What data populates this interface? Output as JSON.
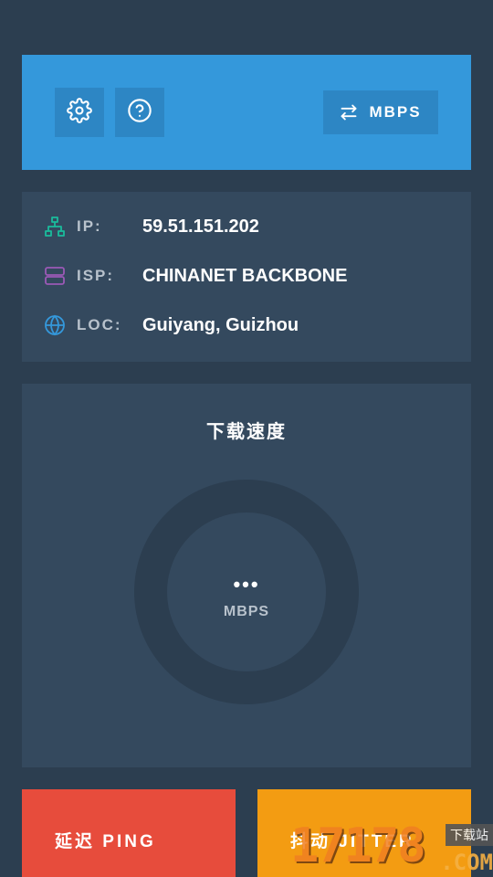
{
  "toolbar": {
    "settings_icon": "gear-icon",
    "help_icon": "question-circle-icon",
    "unit_toggle_icon": "swap-arrows-icon",
    "unit_label": "MBPS"
  },
  "info": {
    "ip": {
      "label": "IP:",
      "value": "59.51.151.202",
      "icon": "network-icon"
    },
    "isp": {
      "label": "ISP:",
      "value": "CHINANET BACKBONE",
      "icon": "server-icon"
    },
    "loc": {
      "label": "LOC:",
      "value": "Guiyang, Guizhou",
      "icon": "globe-icon"
    }
  },
  "speed": {
    "title": "下载速度",
    "value": "•••",
    "unit": "MBPS"
  },
  "tiles": {
    "ping_label": "延迟 PING",
    "jitter_label": "抖动 JITTER"
  },
  "watermark": {
    "number": "17178",
    "domain": ".COM",
    "badge": "下载站"
  },
  "colors": {
    "background": "#2c3e50",
    "card": "#34495e",
    "primary": "#3498db",
    "ping": "#e74c3c",
    "jitter": "#f39c12"
  }
}
